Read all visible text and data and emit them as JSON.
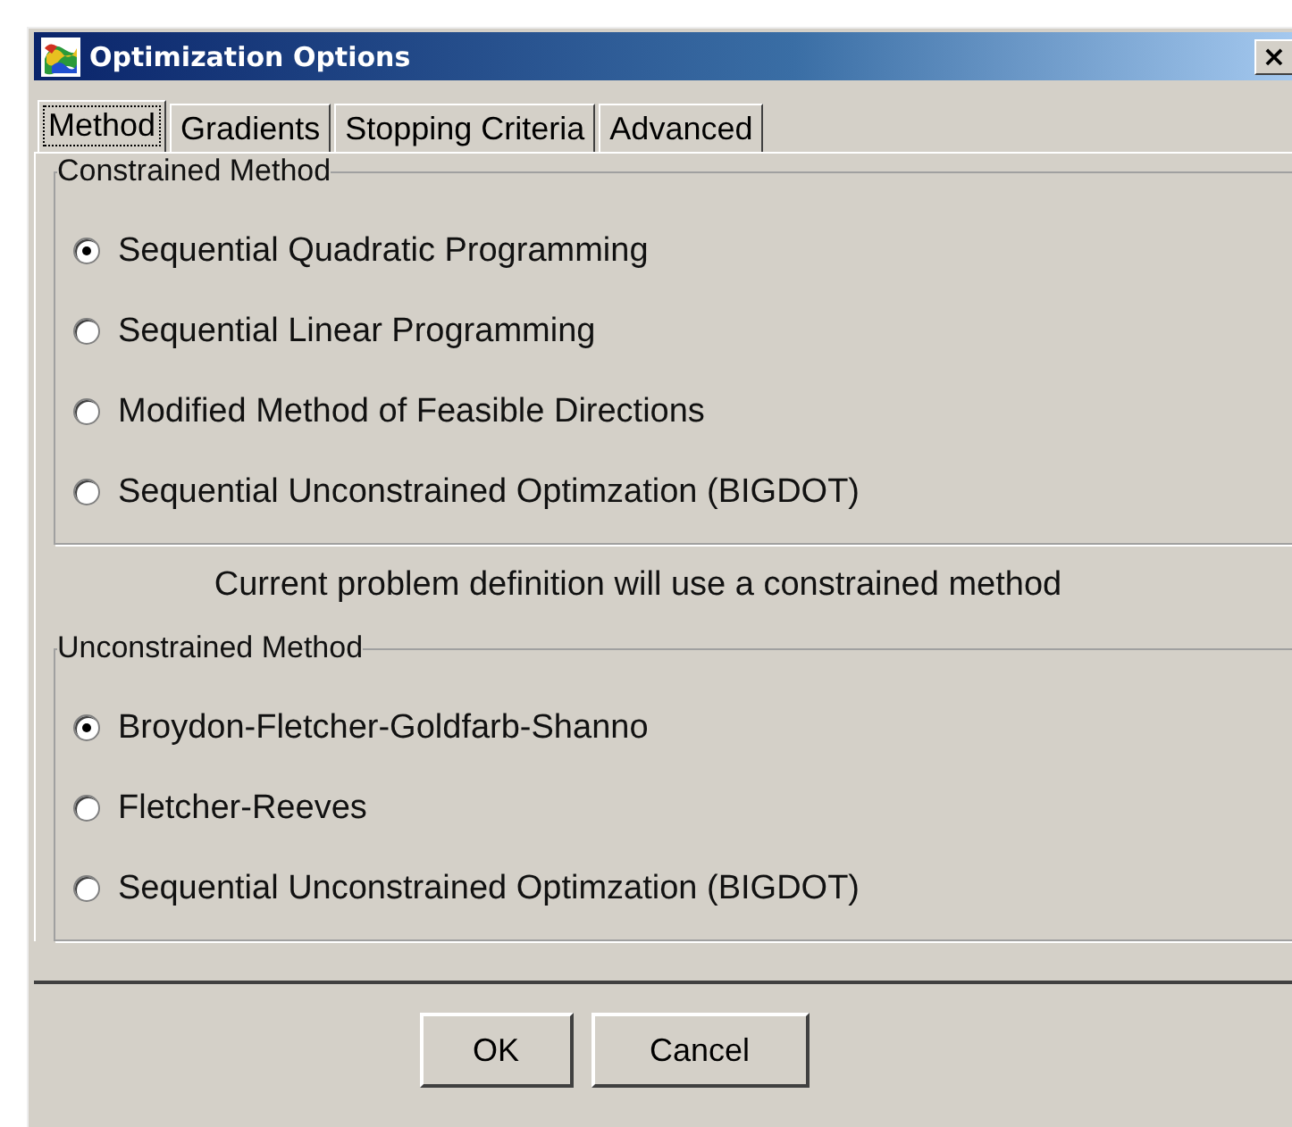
{
  "window": {
    "title": "Optimization Options",
    "close": "×"
  },
  "tabs": [
    {
      "label": "Method",
      "selected": true
    },
    {
      "label": "Gradients",
      "selected": false
    },
    {
      "label": "Stopping Criteria",
      "selected": false
    },
    {
      "label": "Advanced",
      "selected": false
    }
  ],
  "groups": [
    {
      "title": "Constrained Method",
      "options": [
        {
          "label": "Sequential Quadratic Programming",
          "selected": true
        },
        {
          "label": "Sequential Linear Programming",
          "selected": false
        },
        {
          "label": "Modified Method of Feasible Directions",
          "selected": false
        },
        {
          "label": "Sequential Unconstrained Optimzation (BIGDOT)",
          "selected": false
        }
      ]
    },
    {
      "title": "Unconstrained Method",
      "options": [
        {
          "label": "Broydon-Fletcher-Goldfarb-Shanno",
          "selected": true
        },
        {
          "label": "Fletcher-Reeves",
          "selected": false
        },
        {
          "label": "Sequential Unconstrained Optimzation (BIGDOT)",
          "selected": false
        }
      ]
    }
  ],
  "note": "Current problem definition will use a constrained method",
  "buttons": [
    "OK",
    "Cancel"
  ]
}
